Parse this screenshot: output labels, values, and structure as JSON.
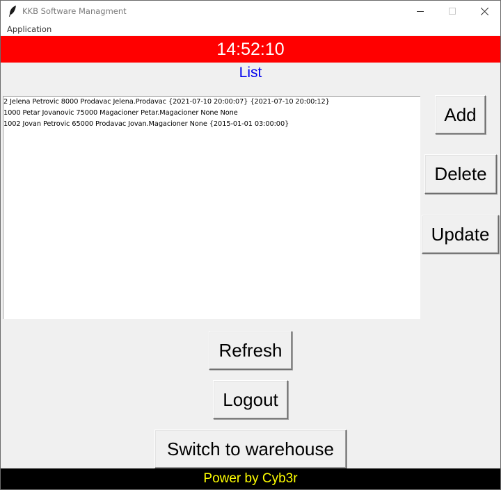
{
  "window": {
    "title": "KKB Software Managment",
    "icon": "feather-icon"
  },
  "menu": {
    "items": [
      "Application"
    ]
  },
  "clock": {
    "time": "14:52:10",
    "background": "#ff0000",
    "color": "#ffffff"
  },
  "list": {
    "title": "List",
    "title_color": "#0000ee",
    "rows": [
      "2 Jelena Petrovic 8000 Prodavac Jelena.Prodavac {2021-07-10 20:00:07} {2021-07-10 20:00:12}",
      "1000 Petar Jovanovic 75000 Magacioner Petar.Magacioner None None",
      "1002 Jovan Petrovic 65000 Prodavac Jovan.Magacioner None {2015-01-01 03:00:00}"
    ]
  },
  "buttons": {
    "add": "Add",
    "delete": "Delete",
    "update": "Update",
    "refresh": "Refresh",
    "logout": "Logout",
    "switch": "Switch to warehouse"
  },
  "footer": {
    "text": "Power by Cyb3r",
    "background": "#000000",
    "color": "#ffff00"
  }
}
